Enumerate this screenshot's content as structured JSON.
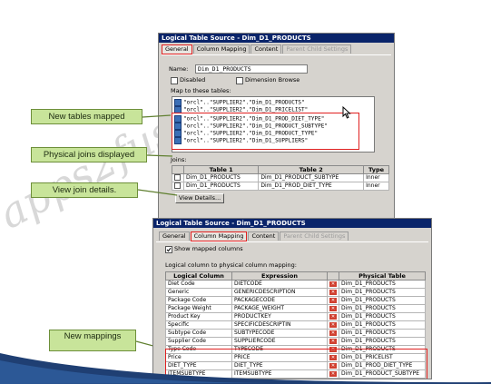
{
  "watermark": "apps2fusion.com",
  "top_window": {
    "title": "Logical Table Source - Dim_D1_PRODUCTS",
    "tabs": [
      "General",
      "Column Mapping",
      "Content",
      "Parent Child Settings"
    ],
    "name_label": "Name:",
    "name_value": "Dim_D1_PRODUCTS",
    "disabled_label": "Disabled",
    "dimension_browse_label": "Dimension Browse",
    "map_tables_label": "Map to these tables:",
    "sources": [
      "\"orcl\"..\"SUPPLIER2\".\"Dim_D1_PRODUCTS\"",
      "\"orcl\"..\"SUPPLIER2\".\"Dim_D1_PRICELIST\"",
      "\"orcl\"..\"SUPPLIER2\".\"Dim_D1_PROD_DIET_TYPE\"",
      "\"orcl\"..\"SUPPLIER2\".\"Dim_D1_PRODUCT_SUBTYPE\"",
      "\"orcl\"..\"SUPPLIER2\".\"Dim_D1_PRODUCT_TYPE\"",
      "\"orcl\"..\"SUPPLIER2\".\"Dim_D1_SUPPLIERS\""
    ],
    "joins_label": "Joins:",
    "joins_headers": [
      "Table 1",
      "Table 2",
      "Type"
    ],
    "joins_rows": [
      [
        "Dim_D1_PRODUCTS",
        "Dim_D1_PRODUCT_SUBTYPE",
        "Inner"
      ],
      [
        "Dim_D1_PRODUCTS",
        "Dim_D1_PROD_DIET_TYPE",
        "Inner"
      ]
    ],
    "view_details_label": "View Details..."
  },
  "callouts": {
    "new_tables": "New tables mapped",
    "physical_joins": "Physical joins displayed",
    "view_join": "View join details.",
    "new_mappings": "New mappings"
  },
  "bottom_window": {
    "title": "Logical Table Source - Dim_D1_PRODUCTS",
    "tabs": [
      "General",
      "Column Mapping",
      "Content",
      "Parent Child Settings"
    ],
    "show_mapped_label": "Show mapped columns",
    "mapping_label": "Logical column to physical column mapping:",
    "headers": [
      "Logical Column",
      "Expression",
      "Physical Table"
    ],
    "rows": [
      [
        "Diet Code",
        "DIETCODE",
        "Dim_D1_PRODUCTS"
      ],
      [
        "Generic",
        "GENERICDESCRIPTION",
        "Dim_D1_PRODUCTS"
      ],
      [
        "Package Code",
        "PACKAGECODE",
        "Dim_D1_PRODUCTS"
      ],
      [
        "Package Weight",
        "PACKAGE_WEIGHT",
        "Dim_D1_PRODUCTS"
      ],
      [
        "Product Key",
        "PRODUCTKEY",
        "Dim_D1_PRODUCTS"
      ],
      [
        "Specific",
        "SPECIFICDESCRIPTIN",
        "Dim_D1_PRODUCTS"
      ],
      [
        "Subtype Code",
        "SUBTYPECODE",
        "Dim_D1_PRODUCTS"
      ],
      [
        "Supplier Code",
        "SUPPLIERCODE",
        "Dim_D1_PRODUCTS"
      ],
      [
        "Type Code",
        "TYPECODE",
        "Dim_D1_PRODUCTS"
      ],
      [
        "Price",
        "PRICE",
        "Dim_D1_PRICELIST"
      ],
      [
        "DIET_TYPE",
        "DIET_TYPE",
        "Dim_D1_PROD_DIET_TYPE"
      ],
      [
        "ITEMSUBTYPE",
        "ITEMSUBTYPE",
        "Dim_D1_PRODUCT_SUBTYPE"
      ],
      [
        "ITEMTYPE",
        "ITEMTYPE",
        "Dim_D1_PRODUCT_TYPE"
      ],
      [
        "ITEMSUPPLIER",
        "ITEMSUPPLIER",
        "Dim_D1_SUPPLIERS"
      ]
    ]
  }
}
